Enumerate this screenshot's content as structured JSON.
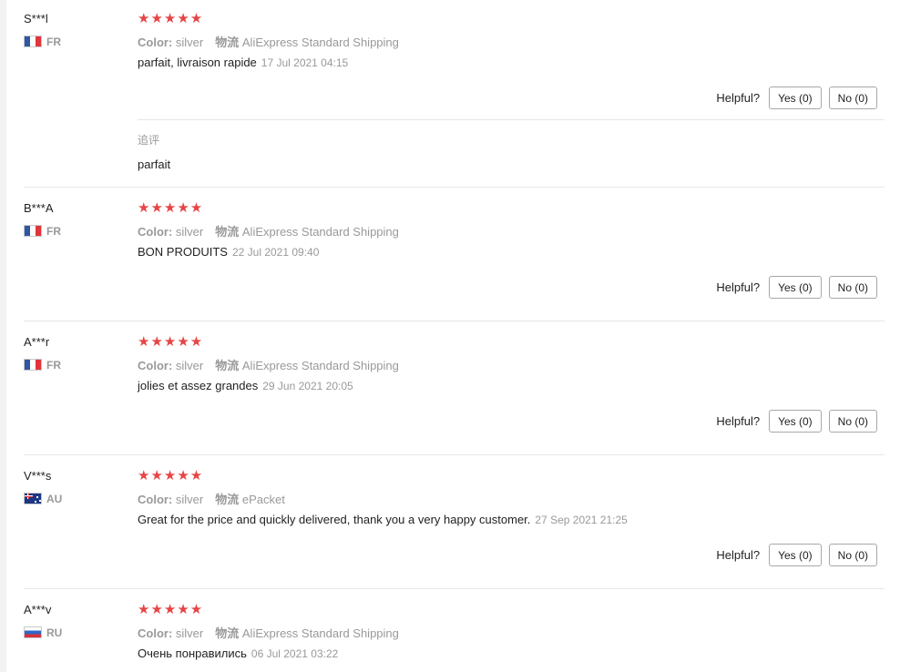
{
  "labels": {
    "color": "Color:",
    "logistics": "物流",
    "helpful": "Helpful?",
    "yes": "Yes (0)",
    "no": "No (0)",
    "followup": "追评"
  },
  "stars": "★★★★★",
  "reviews": [
    {
      "user": "S***l",
      "country": "FR",
      "rating": 5,
      "color": "silver",
      "shipping": "AliExpress Standard Shipping",
      "text": "parfait, livraison rapide",
      "date": "17 Jul 2021 04:15",
      "followup_text": "parfait"
    },
    {
      "user": "B***A",
      "country": "FR",
      "rating": 5,
      "color": "silver",
      "shipping": "AliExpress Standard Shipping",
      "text": "BON PRODUITS",
      "date": "22 Jul 2021 09:40"
    },
    {
      "user": "A***r",
      "country": "FR",
      "rating": 5,
      "color": "silver",
      "shipping": "AliExpress Standard Shipping",
      "text": "jolies et assez grandes",
      "date": "29 Jun 2021 20:05"
    },
    {
      "user": "V***s",
      "country": "AU",
      "rating": 5,
      "color": "silver",
      "shipping": "ePacket",
      "text": "Great for the price and quickly delivered, thank you a very happy customer.",
      "date": "27 Sep 2021 21:25"
    },
    {
      "user": "A***v",
      "country": "RU",
      "rating": 5,
      "color": "silver",
      "shipping": "AliExpress Standard Shipping",
      "text": "Очень понравились",
      "date": "06 Jul 2021 03:22"
    }
  ],
  "colors": {
    "star": "#e64545",
    "muted": "#999999",
    "border": "#a8a8a8"
  }
}
